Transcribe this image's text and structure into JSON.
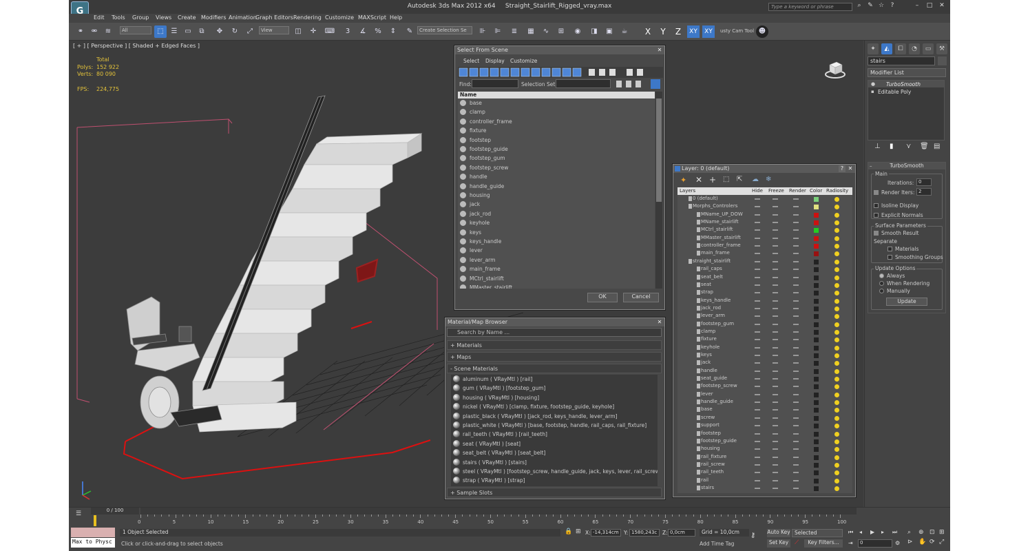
{
  "title_bar": {
    "app": "Autodesk 3ds Max  2012 x64",
    "file": "Straight_Stairlift_Rigged_vray.max",
    "search_placeholder": "Type a keyword or phrase"
  },
  "menu": [
    "Edit",
    "Tools",
    "Group",
    "Views",
    "Create",
    "Modifiers",
    "Animation",
    "Graph Editors",
    "Rendering",
    "Customize",
    "MAXScript",
    "Help"
  ],
  "toolbar": {
    "filter_value": "All",
    "coord_value": "View",
    "named_selection": "Create Selection Se",
    "axis": [
      "X",
      "Y",
      "Z",
      "XY",
      "XY"
    ],
    "caddy_label": "usty Cam Tool"
  },
  "viewport": {
    "label": "[ + ] [ Perspective ] [ Shaded + Edged Faces ]",
    "stats_header": "Total",
    "polys_label": "Polys:",
    "polys_value": "152 922",
    "verts_label": "Verts:",
    "verts_value": "80 090",
    "fps_label": "FPS:",
    "fps_value": "224,775"
  },
  "select_from_scene": {
    "title": "Select From Scene",
    "menu": [
      "Select",
      "Display",
      "Customize"
    ],
    "find_label": "Find:",
    "selection_set_label": "Selection Set:",
    "column": "Name",
    "items": [
      "base",
      "clamp",
      "controller_frame",
      "fixture",
      "footstep",
      "footstep_guide",
      "footstep_gum",
      "footstep_screw",
      "handle",
      "handle_guide",
      "housing",
      "jack",
      "jack_rod",
      "keyhole",
      "keys",
      "keys_handle",
      "lever",
      "lever_arm",
      "main_frame",
      "MCtrl_stairlift",
      "MMaster_stairlift"
    ],
    "ok": "OK",
    "cancel": "Cancel"
  },
  "material_browser": {
    "title": "Material/Map Browser",
    "search_placeholder": "Search by Name ...",
    "sections": [
      "+ Materials",
      "+ Maps",
      "- Scene Materials",
      "+ Sample Slots"
    ],
    "materials": [
      "aluminum  ( VRayMtl )  [rail]",
      "gum  ( VRayMtl )  [footstep_gum]",
      "housing  ( VRayMtl )  [housing]",
      "nickel  ( VRayMtl )  [clamp, fixture, footstep_guide, keyhole]",
      "plastic_black  ( VRayMtl )  [jack_rod, keys_handle, lever_arm]",
      "plastic_white  ( VRayMtl )  [base, footstep, handle, rail_caps, rail_fixture]",
      "rail_teeth  ( VRayMtl )  [rail_teeth]",
      "seat  ( VRayMtl )  [seat]",
      "seat_belt  ( VRayMtl )  [seat_belt]",
      "stairs  ( VRayMtl )  [stairs]",
      "steel  ( VRayMtl )  [footstep_screw, handle_guide, jack, keys, lever, rail_screw, s...",
      "strap  ( VRayMtl )  [strap]"
    ]
  },
  "layer_manager": {
    "title": "Layer: 0 (default)",
    "columns": [
      "Layers",
      "Hide",
      "Freeze",
      "Render",
      "Color",
      "Radiosity"
    ],
    "rows": [
      {
        "name": "0 (default)",
        "indent": 0,
        "color": "#7ad07a"
      },
      {
        "name": "Morphs_Controlers",
        "indent": 0,
        "color": "#e0e080"
      },
      {
        "name": "MName_UP_DOW",
        "indent": 1,
        "color": "#cc1111"
      },
      {
        "name": "MName_stairlift",
        "indent": 1,
        "color": "#cc1111"
      },
      {
        "name": "MCtrl_stairlift",
        "indent": 1,
        "color": "#22cc22"
      },
      {
        "name": "MMaster_stairlift",
        "indent": 1,
        "color": "#cc1111"
      },
      {
        "name": "controller_frame",
        "indent": 1,
        "color": "#cc1111"
      },
      {
        "name": "main_frame",
        "indent": 1,
        "color": "#991111"
      },
      {
        "name": "straight_stairlift",
        "indent": 0,
        "color": "#222222"
      },
      {
        "name": "rail_caps",
        "indent": 1,
        "color": "#222222"
      },
      {
        "name": "seat_belt",
        "indent": 1,
        "color": "#222222"
      },
      {
        "name": "seat",
        "indent": 1,
        "color": "#222222"
      },
      {
        "name": "strap",
        "indent": 1,
        "color": "#222222"
      },
      {
        "name": "keys_handle",
        "indent": 1,
        "color": "#222222"
      },
      {
        "name": "jack_rod",
        "indent": 1,
        "color": "#222222"
      },
      {
        "name": "lever_arm",
        "indent": 1,
        "color": "#222222"
      },
      {
        "name": "footstep_gum",
        "indent": 1,
        "color": "#222222"
      },
      {
        "name": "clamp",
        "indent": 1,
        "color": "#222222"
      },
      {
        "name": "fixture",
        "indent": 1,
        "color": "#222222"
      },
      {
        "name": "keyhole",
        "indent": 1,
        "color": "#222222"
      },
      {
        "name": "keys",
        "indent": 1,
        "color": "#222222"
      },
      {
        "name": "jack",
        "indent": 1,
        "color": "#222222"
      },
      {
        "name": "handle",
        "indent": 1,
        "color": "#222222"
      },
      {
        "name": "seat_guide",
        "indent": 1,
        "color": "#222222"
      },
      {
        "name": "footstep_screw",
        "indent": 1,
        "color": "#222222"
      },
      {
        "name": "lever",
        "indent": 1,
        "color": "#222222"
      },
      {
        "name": "handle_guide",
        "indent": 1,
        "color": "#222222"
      },
      {
        "name": "base",
        "indent": 1,
        "color": "#222222"
      },
      {
        "name": "screw",
        "indent": 1,
        "color": "#222222"
      },
      {
        "name": "support",
        "indent": 1,
        "color": "#222222"
      },
      {
        "name": "footstep",
        "indent": 1,
        "color": "#222222"
      },
      {
        "name": "footstep_guide",
        "indent": 1,
        "color": "#222222"
      },
      {
        "name": "housing",
        "indent": 1,
        "color": "#222222"
      },
      {
        "name": "rail_fixture",
        "indent": 1,
        "color": "#222222"
      },
      {
        "name": "rail_screw",
        "indent": 1,
        "color": "#222222"
      },
      {
        "name": "rail_teeth",
        "indent": 1,
        "color": "#222222"
      },
      {
        "name": "rail",
        "indent": 1,
        "color": "#222222"
      },
      {
        "name": "stairs",
        "indent": 1,
        "color": "#222222"
      }
    ]
  },
  "command_panel": {
    "object_name": "stairs",
    "modifier_list": "Modifier List",
    "stack": [
      "TurboSmooth",
      "Editable Poly"
    ],
    "rollout_title": "TurboSmooth",
    "main_label": "Main",
    "iterations_label": "Iterations:",
    "iterations_value": "0",
    "render_iters_label": "Render Iters:",
    "render_iters_value": "2",
    "isoline": "Isoline Display",
    "explicit_normals": "Explicit Normals",
    "surface_params": "Surface Parameters",
    "smooth_result": "Smooth Result",
    "separate": "Separate",
    "materials": "Materials",
    "smoothing_groups": "Smoothing Groups",
    "update_options": "Update Options",
    "always": "Always",
    "when_rendering": "When Rendering",
    "manually": "Manually",
    "update_button": "Update"
  },
  "timeline": {
    "frame_display": "0 / 100",
    "ticks": [
      "0",
      "5",
      "10",
      "15",
      "20",
      "25",
      "30",
      "35",
      "40",
      "45",
      "50",
      "55",
      "60",
      "65",
      "70",
      "75",
      "80",
      "85",
      "90",
      "95",
      "100"
    ]
  },
  "status": {
    "maxscript": "Max to Physc",
    "selected": "1 Object Selected",
    "prompt": "Click or click-and-drag to select objects",
    "x_label": "X:",
    "x_value": "-14,314cm",
    "y_label": "Y:",
    "y_value": "1580,243c",
    "z_label": "Z:",
    "z_value": "0,0cm",
    "grid": "Grid = 10,0cm",
    "add_time_tag": "Add Time Tag",
    "auto_key": "Auto Key",
    "set_key": "Set Key",
    "key_mode_value": "Selected",
    "key_filters": "Key Filters...",
    "frame_value": "0"
  }
}
